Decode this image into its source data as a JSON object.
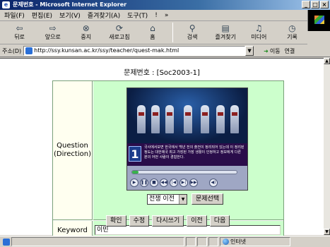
{
  "window": {
    "title": "문제번호 - Microsoft Internet Explorer",
    "controls": [
      "_",
      "□",
      "×"
    ]
  },
  "menu": [
    "파일(F)",
    "편집(E)",
    "보기(V)",
    "즐겨찾기(A)",
    "도구(T)",
    "!",
    "»"
  ],
  "toolbar": {
    "back": "뒤로",
    "forward": "앞으로",
    "stop": "중지",
    "refresh": "새로고침",
    "home": "홈",
    "search": "검색",
    "favorites": "즐겨찾기",
    "media": "미디어",
    "history": "기록"
  },
  "address": {
    "label": "주소(D)",
    "url": "http://ssy.kunsan.ac.kr/ssy/teacher/quest-mak.html",
    "go_label": "이동",
    "links_label": "연결"
  },
  "page": {
    "title": "문제번호 : [Soc2003-1]",
    "question_label_line1": "Question",
    "question_label_line2": "(Direction)",
    "video": {
      "question_number": "1",
      "subtitle": "국사에서보면 한국에서 백년 전의 출전이 정리되어 있는데 이 정리된 정도는 대한제국 최고 가장된 가장 생활이 인정하고 정보에게 다른 분의 어떤 사람이 경험한다."
    },
    "progress": 0.06,
    "select_value": "전쟁 이전",
    "select_button": "문제선택",
    "keyword_label": "Keyword",
    "keyword_value": "이민",
    "buttons": [
      "확인",
      "수정",
      "다시쓰기",
      "이전",
      "다음"
    ]
  },
  "status": {
    "zone": "인터넷"
  }
}
